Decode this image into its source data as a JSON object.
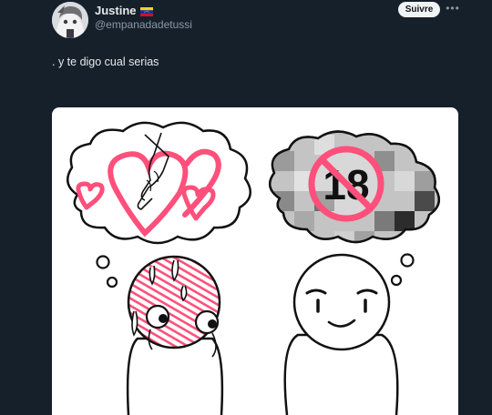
{
  "author": {
    "display_name": "Justine",
    "handle": "@empanadadetussi",
    "flag_icon": "venezuela-flag-icon",
    "avatar_icon": "anime-avatar-icon"
  },
  "actions": {
    "follow_label": "Suivre",
    "more_icon": "more-dots-icon"
  },
  "tweet": {
    "text": ". y te digo cual serias"
  },
  "media": {
    "badge_text": "18",
    "badge_icon": "no-under-18-icon",
    "colors": {
      "accent": "#ff4f7b",
      "background": "#15202b",
      "follow_bg": "#eff3f4"
    }
  }
}
